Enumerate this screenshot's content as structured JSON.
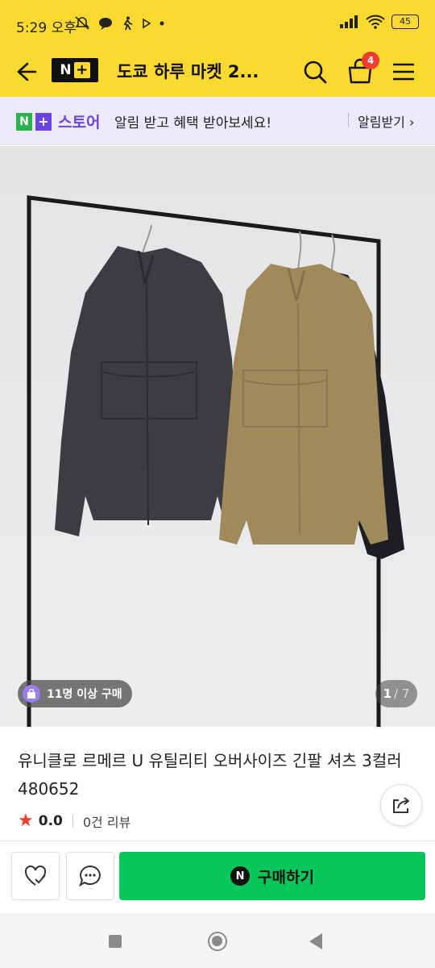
{
  "status_bar": {
    "time": "5:29 오후",
    "battery": "45",
    "icons": [
      "muted-bell-icon",
      "chat-bubble-icon",
      "walking-icon",
      "play-icon",
      "dot-icon",
      "signal-icon",
      "wifi-icon",
      "battery-icon"
    ]
  },
  "header": {
    "logo_text": "N",
    "logo_plus": "+",
    "title": "도쿄 하루 마켓 2...",
    "cart_count": "4",
    "icons": [
      "back-arrow-icon",
      "search-icon",
      "cart-icon",
      "menu-icon"
    ]
  },
  "banner": {
    "brand_n": "N",
    "brand_plus": "+",
    "brand_label": "스토어",
    "message": "알림 받고 혜택 받아보세요!",
    "action": "알림받기 ›"
  },
  "hero": {
    "buyers": "11명 이상 구매",
    "page_current": "1",
    "page_total": "/ 7"
  },
  "product": {
    "name": "유니클로 르메르 U 유틸리티 오버사이즈 긴팔 셔츠 3컬러 480652",
    "rating": "0.0",
    "reviews": "0건 리뷰"
  },
  "actions": {
    "buy_icon_letter": "N",
    "buy_label": "구매하기"
  },
  "colors": {
    "brand_yellow": "#fbd92f",
    "badge_red": "#f33a2e",
    "buy_green": "#07c65a",
    "store_purple": "#6a45e0"
  }
}
